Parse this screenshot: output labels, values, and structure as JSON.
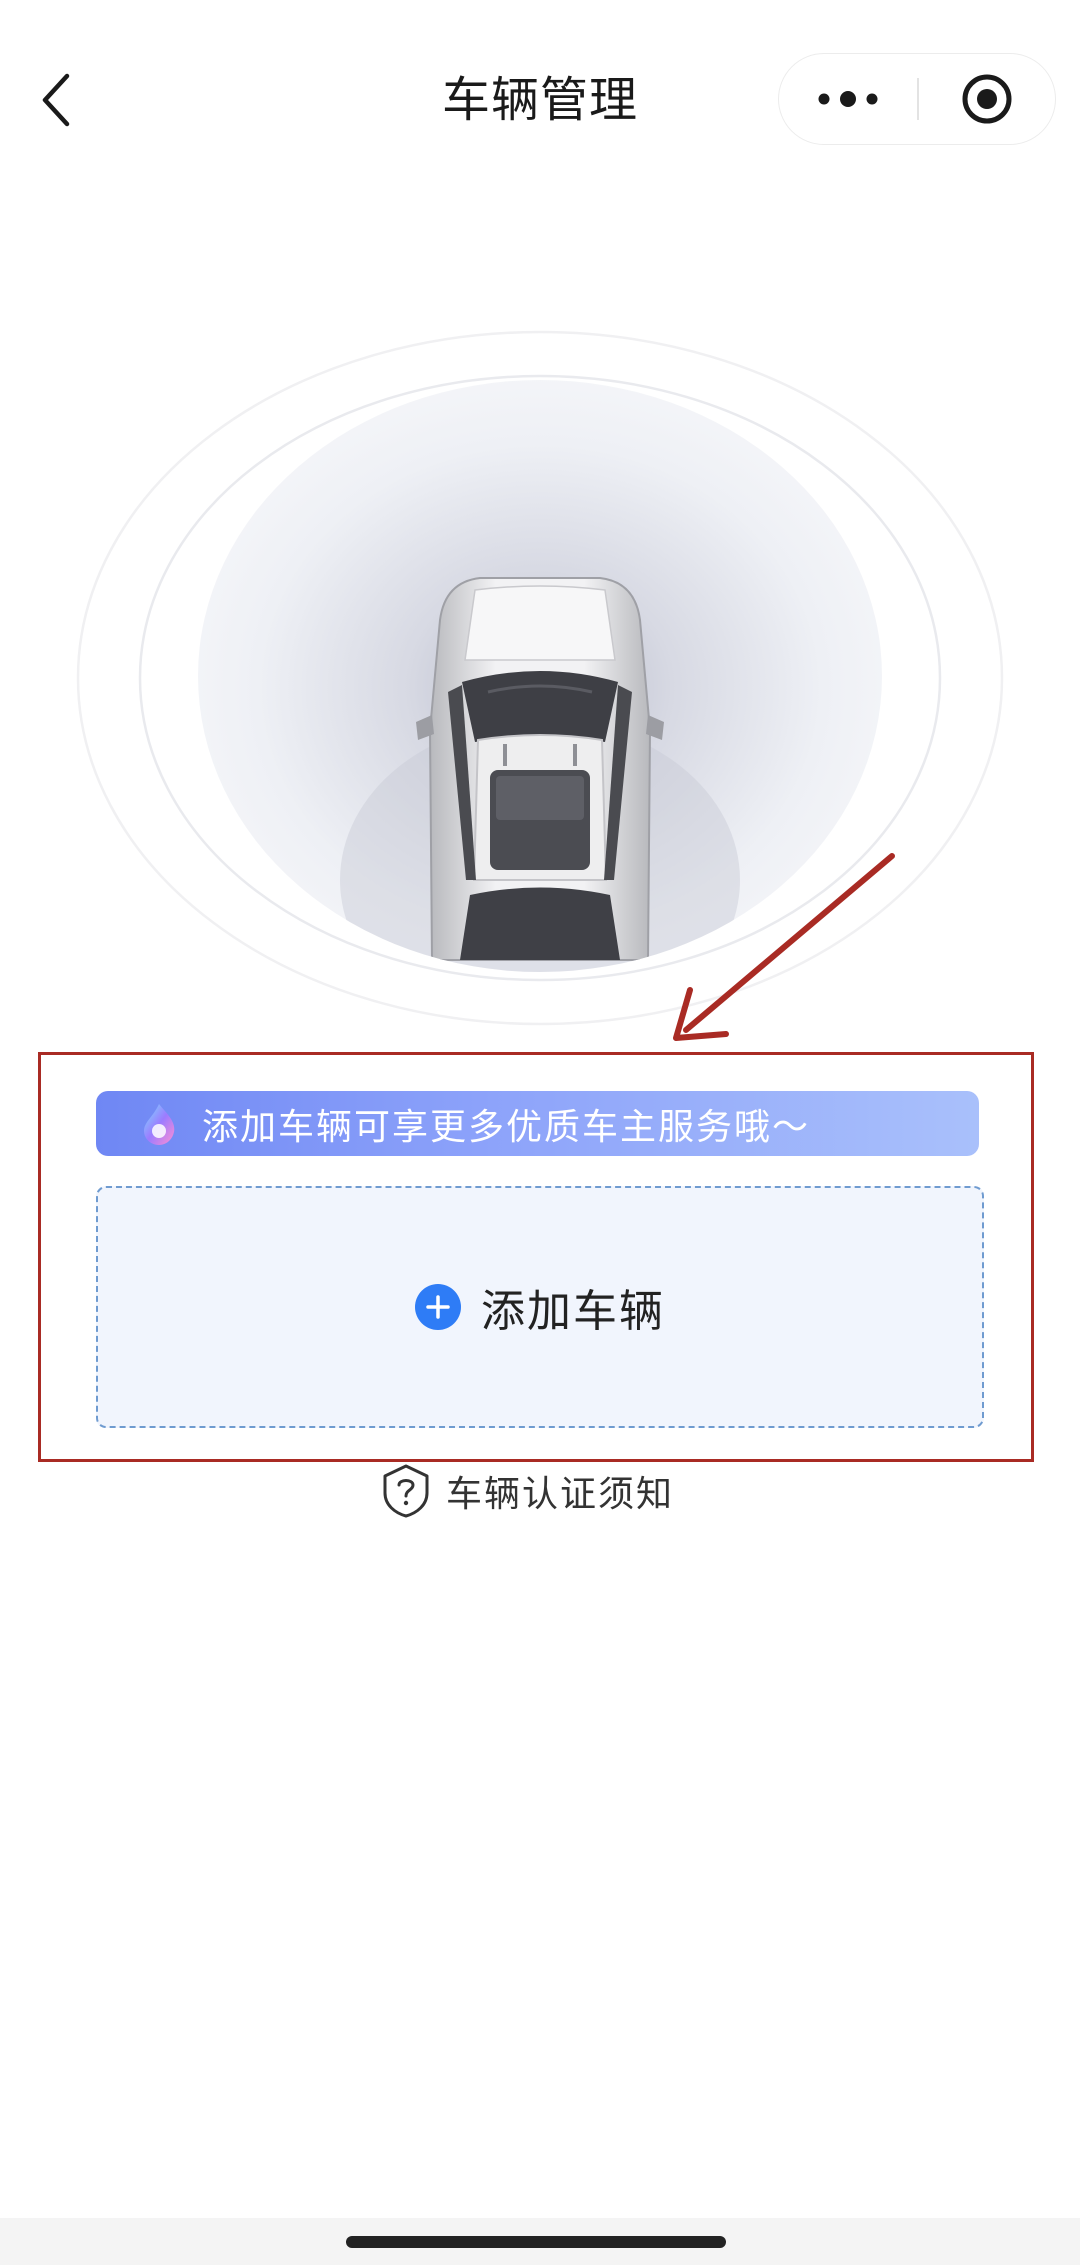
{
  "header": {
    "title": "车辆管理"
  },
  "promo": {
    "text": "添加车辆可享更多优质车主服务哦～"
  },
  "add_vehicle": {
    "label": "添加车辆"
  },
  "notice": {
    "label": "车辆认证须知"
  },
  "icons": {
    "back": "chevron-left-icon",
    "more": "more-dots-icon",
    "close": "target-close-icon",
    "promo": "assistant-flame-icon",
    "add": "plus-circle-icon",
    "notice": "shield-question-icon"
  },
  "colors": {
    "accent": "#2e7cf6",
    "banner_start": "#6f87f4",
    "banner_end": "#a9c0fb",
    "card_bg": "#f1f5fd",
    "annotation": "#a92b24"
  }
}
